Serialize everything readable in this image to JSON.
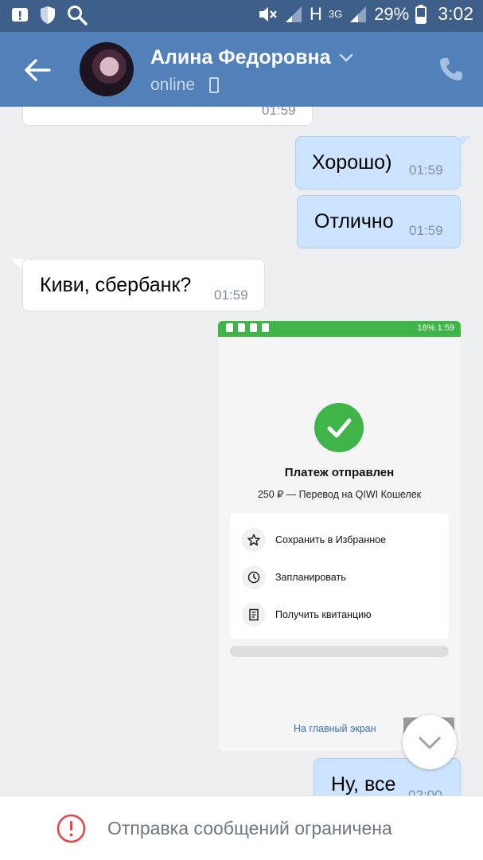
{
  "status_bar": {
    "battery": "29%",
    "time": "3:02",
    "net_h": "H",
    "net_3g": "3G"
  },
  "header": {
    "name": "Алина Федоровна",
    "status": "online"
  },
  "messages": [
    {
      "dir": "in",
      "text": "",
      "time": "01:59"
    },
    {
      "dir": "out",
      "text": "Хорошо)",
      "time": "01:59"
    },
    {
      "dir": "out",
      "text": "Отлично",
      "time": "01:59"
    },
    {
      "dir": "in",
      "text": "Киви, сбербанк?",
      "time": "01:59"
    },
    {
      "dir": "out",
      "text": "Ну, все",
      "time": "02:00"
    }
  ],
  "attachment": {
    "status_right": "18%  1:59",
    "title": "Платеж отправлен",
    "subtitle": "250 ₽ — Перевод на QIWI Кошелек",
    "actions": [
      {
        "label": "Сохранить в Избранное",
        "icon": "star-icon"
      },
      {
        "label": "Запланировать",
        "icon": "clock-icon"
      },
      {
        "label": "Получить квитанцию",
        "icon": "receipt-icon"
      }
    ],
    "home_link": "На главный экран"
  },
  "bottom": {
    "notice": "Отправка сообщений ограничена"
  },
  "colors": {
    "header": "#5181b8",
    "status_bar": "#3d5f8a",
    "outgoing_bubble": "#cce4ff",
    "incoming_bubble": "#ffffff",
    "qiwi_green": "#3eb449",
    "warning": "#e64646"
  }
}
